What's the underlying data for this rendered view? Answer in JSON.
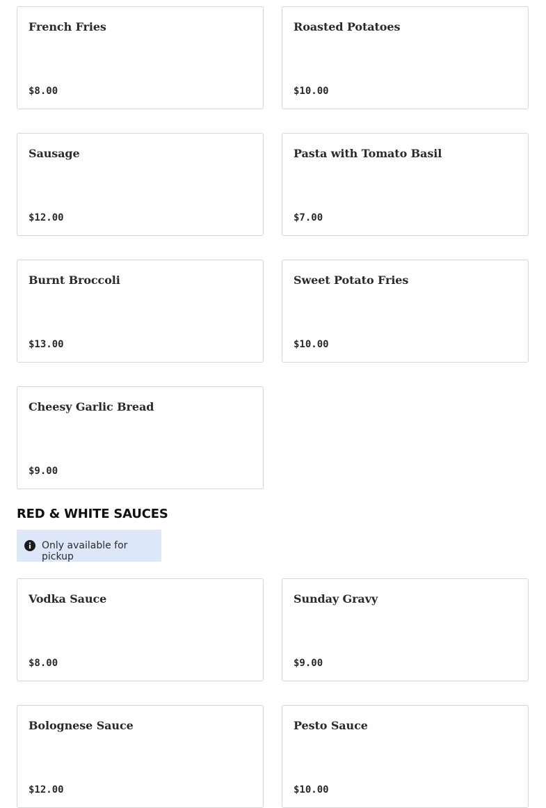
{
  "sides": {
    "items": [
      {
        "name": "French Fries",
        "price": "$8.00"
      },
      {
        "name": "Roasted Potatoes",
        "price": "$10.00"
      },
      {
        "name": "Sausage",
        "price": "$12.00"
      },
      {
        "name": "Pasta with Tomato Basil",
        "price": "$7.00"
      },
      {
        "name": "Burnt Broccoli",
        "price": "$13.00"
      },
      {
        "name": "Sweet Potato Fries",
        "price": "$10.00"
      },
      {
        "name": "Cheesy Garlic Bread",
        "price": "$9.00"
      }
    ]
  },
  "sauces": {
    "title": "RED & WHITE SAUCES",
    "notice": {
      "icon": "info-icon",
      "text": "Only available for pickup"
    },
    "items": [
      {
        "name": "Vodka Sauce",
        "price": "$8.00"
      },
      {
        "name": "Sunday Gravy",
        "price": "$9.00"
      },
      {
        "name": "Bolognese Sauce",
        "price": "$12.00"
      },
      {
        "name": "Pesto Sauce",
        "price": "$10.00"
      }
    ]
  }
}
